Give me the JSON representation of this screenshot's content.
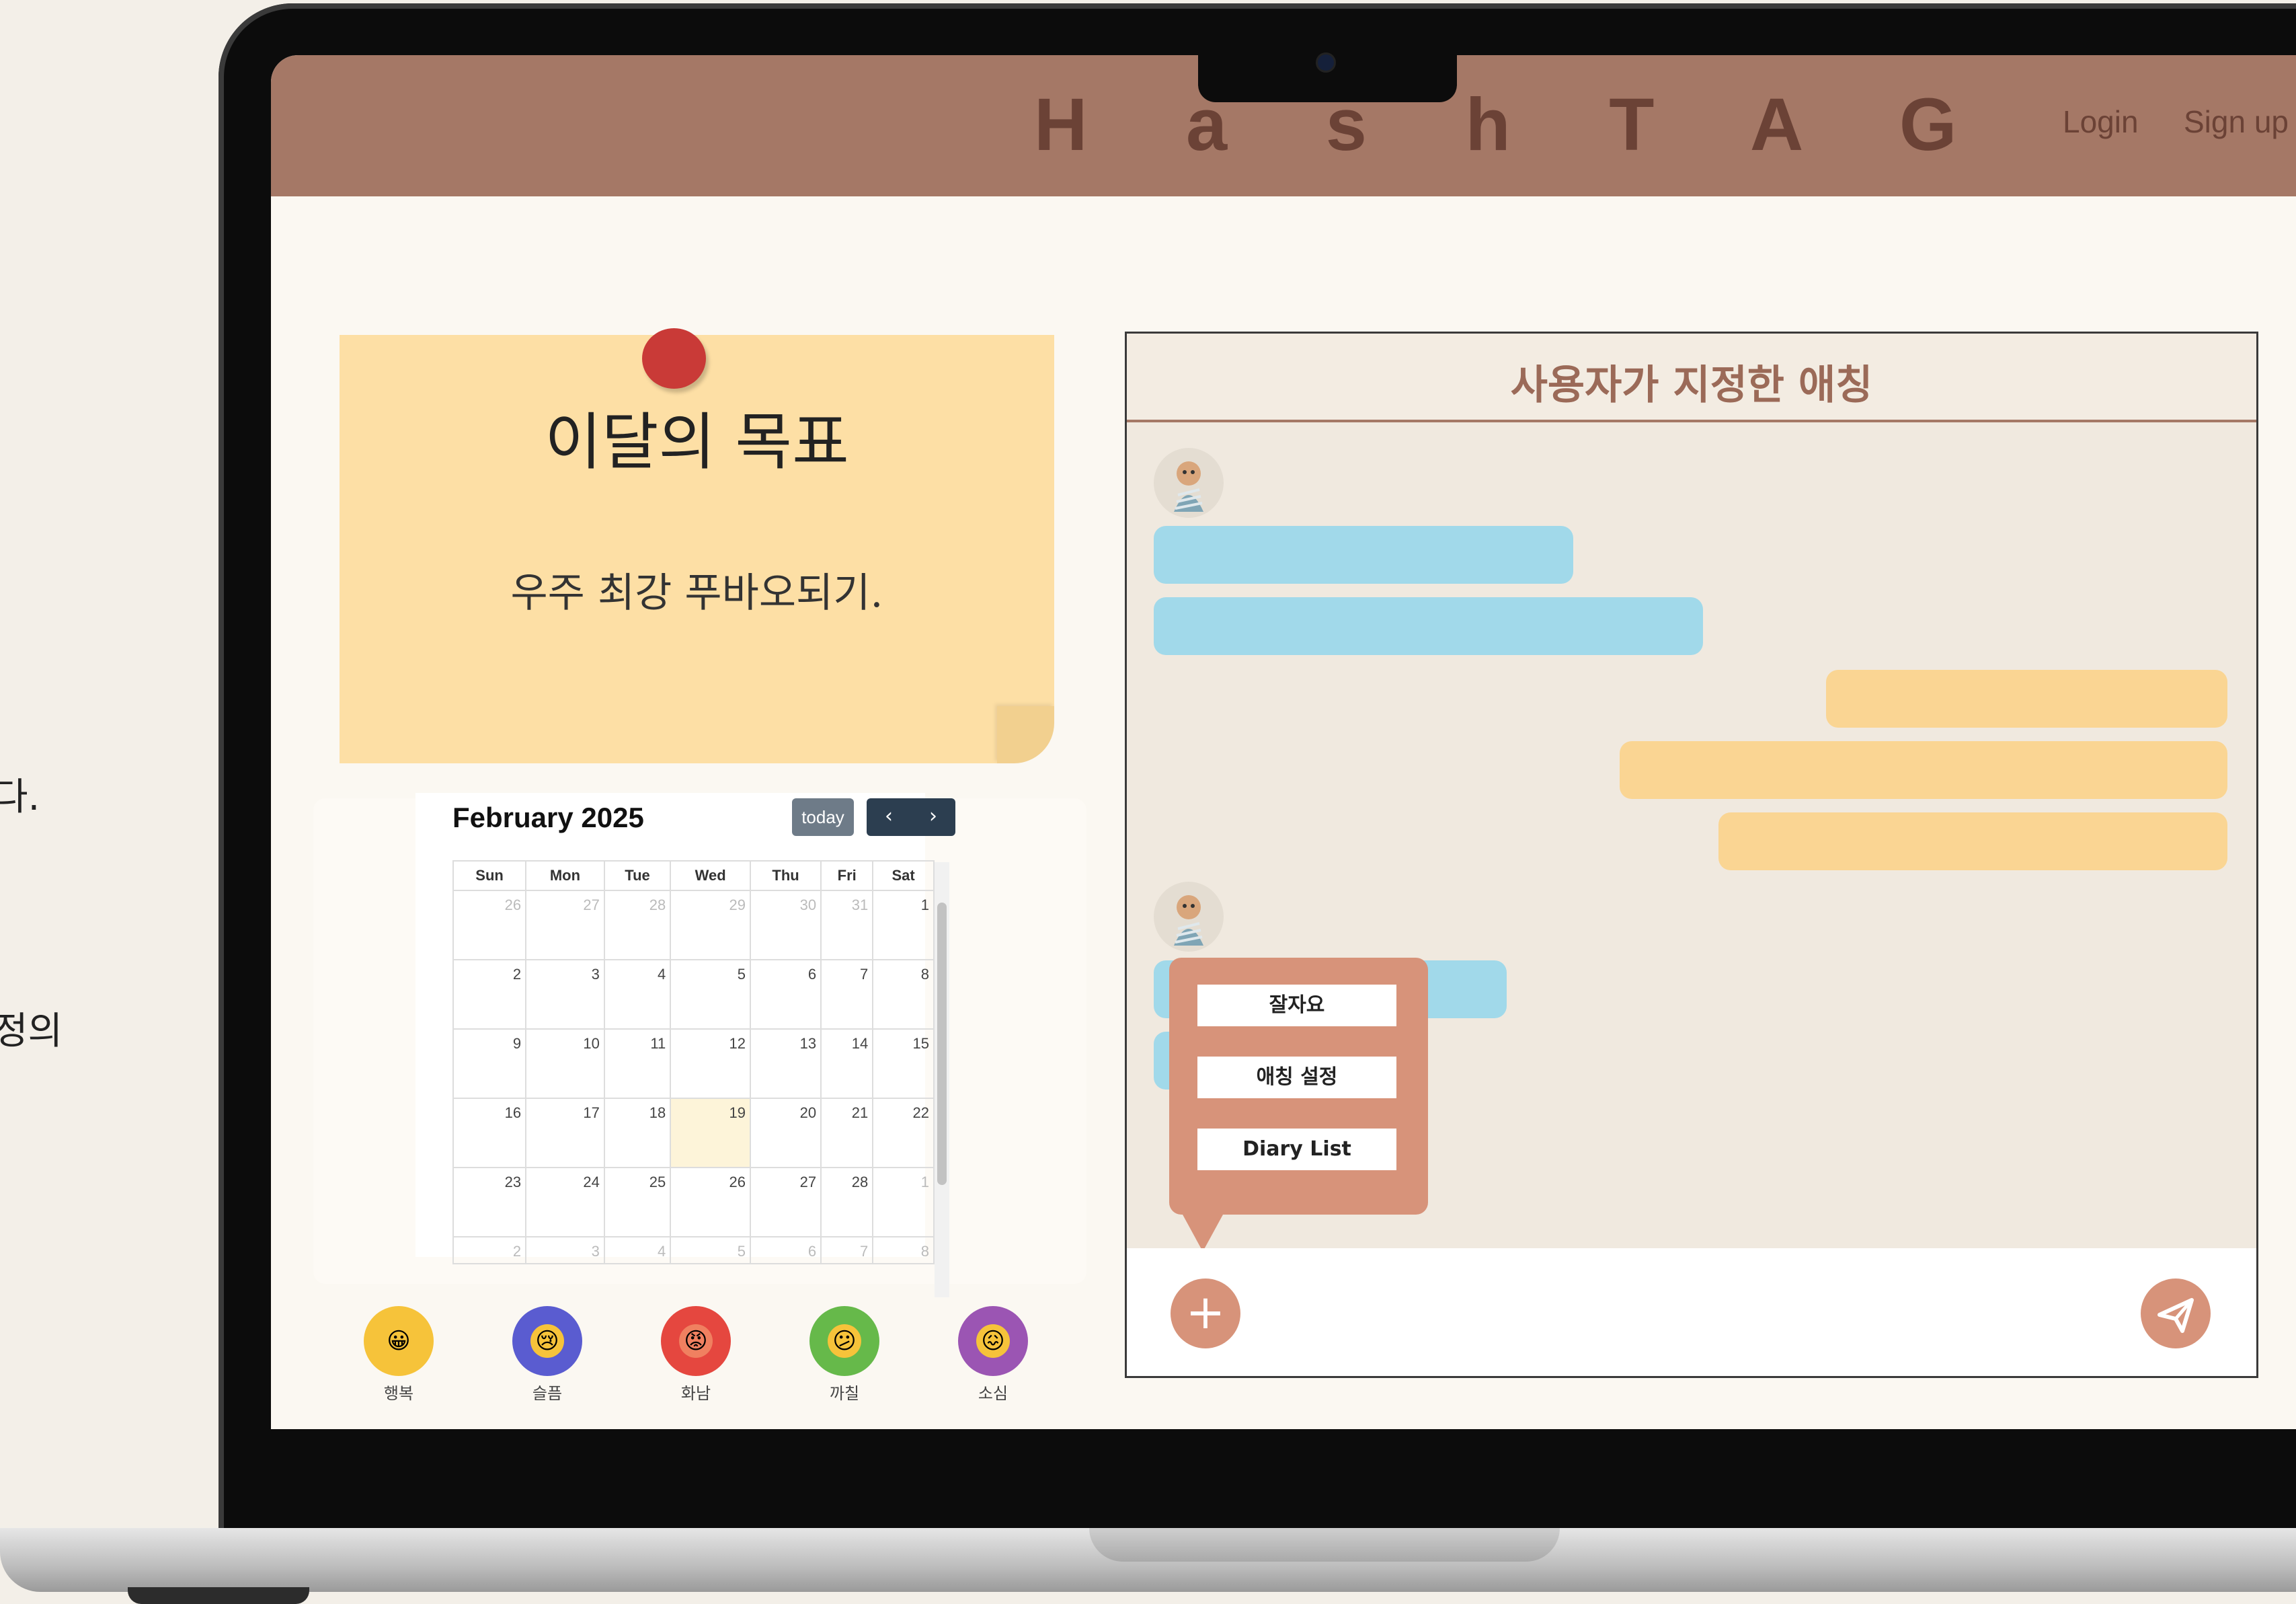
{
  "side_text": [
    "다.",
    "정의"
  ],
  "header": {
    "logo": "H a s h T A G",
    "login": "Login",
    "signup": "Sign up"
  },
  "goal": {
    "title": "이달의 목표",
    "body": "우주 최강 푸바오되기."
  },
  "calendar": {
    "title": "February 2025",
    "today_label": "today",
    "prev_icon": "‹",
    "next_icon": "›",
    "weekdays": [
      "Sun",
      "Mon",
      "Tue",
      "Wed",
      "Thu",
      "Fri",
      "Sat"
    ],
    "weeks": [
      [
        "26",
        "27",
        "28",
        "29",
        "30",
        "31",
        "1"
      ],
      [
        "2",
        "3",
        "4",
        "5",
        "6",
        "7",
        "8"
      ],
      [
        "9",
        "10",
        "11",
        "12",
        "13",
        "14",
        "15"
      ],
      [
        "16",
        "17",
        "18",
        "19",
        "20",
        "21",
        "22"
      ],
      [
        "23",
        "24",
        "25",
        "26",
        "27",
        "28",
        "1"
      ],
      [
        "2",
        "3",
        "4",
        "5",
        "6",
        "7",
        "8"
      ]
    ]
  },
  "emotions": [
    {
      "label": "행복",
      "color": "#f6c33a",
      "icon": "grinning-face-icon"
    },
    {
      "label": "슬픔",
      "color": "#5a5cd0",
      "icon": "crying-face-icon"
    },
    {
      "label": "화남",
      "color": "#e5473f",
      "icon": "angry-face-icon"
    },
    {
      "label": "까칠",
      "color": "#66b94a",
      "icon": "confused-face-icon"
    },
    {
      "label": "소심",
      "color": "#9b55b3",
      "icon": "anxious-face-icon"
    }
  ],
  "chat": {
    "title": "사용자가 지정한 애칭",
    "menu": [
      "잘자요",
      "애칭 설정",
      "Diary List"
    ],
    "plus_icon": "+",
    "send_icon": "paper-plane-icon"
  },
  "colors": {
    "header": "#a57866",
    "accent": "#d7937a",
    "user_bubble": "#fad593",
    "bot_bubble": "#a1d9ea"
  }
}
